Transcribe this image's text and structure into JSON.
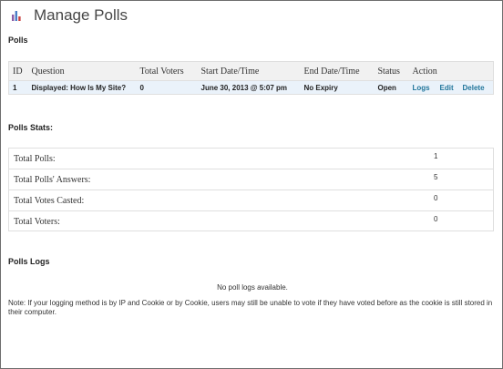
{
  "page": {
    "title": "Manage Polls",
    "icon": "bar-chart-icon"
  },
  "polls": {
    "heading": "Polls",
    "columns": [
      "ID",
      "Question",
      "Total Voters",
      "Start Date/Time",
      "End Date/Time",
      "Status",
      "Action"
    ],
    "rows": [
      {
        "id": "1",
        "question": "Displayed: How Is My Site?",
        "total_voters": "0",
        "start": "June 30, 2013 @ 5:07 pm",
        "end": "No Expiry",
        "status": "Open",
        "actions": [
          "Logs",
          "Edit",
          "Delete"
        ]
      }
    ]
  },
  "stats": {
    "heading": "Polls Stats:",
    "rows": [
      {
        "label": "Total Polls:",
        "value": "1"
      },
      {
        "label": "Total Polls' Answers:",
        "value": "5"
      },
      {
        "label": "Total Votes Casted:",
        "value": "0"
      },
      {
        "label": "Total Voters:",
        "value": "0"
      }
    ]
  },
  "logs": {
    "heading": "Polls Logs",
    "empty_text": "No poll logs available.",
    "note": "Note: If your logging method is by IP and Cookie or by Cookie, users may still be unable to vote if they have voted before as the cookie is still stored in their computer."
  },
  "colors": {
    "link": "#21759b",
    "row_highlight": "#eaf2fa",
    "header_bg": "#f1f1f1"
  }
}
